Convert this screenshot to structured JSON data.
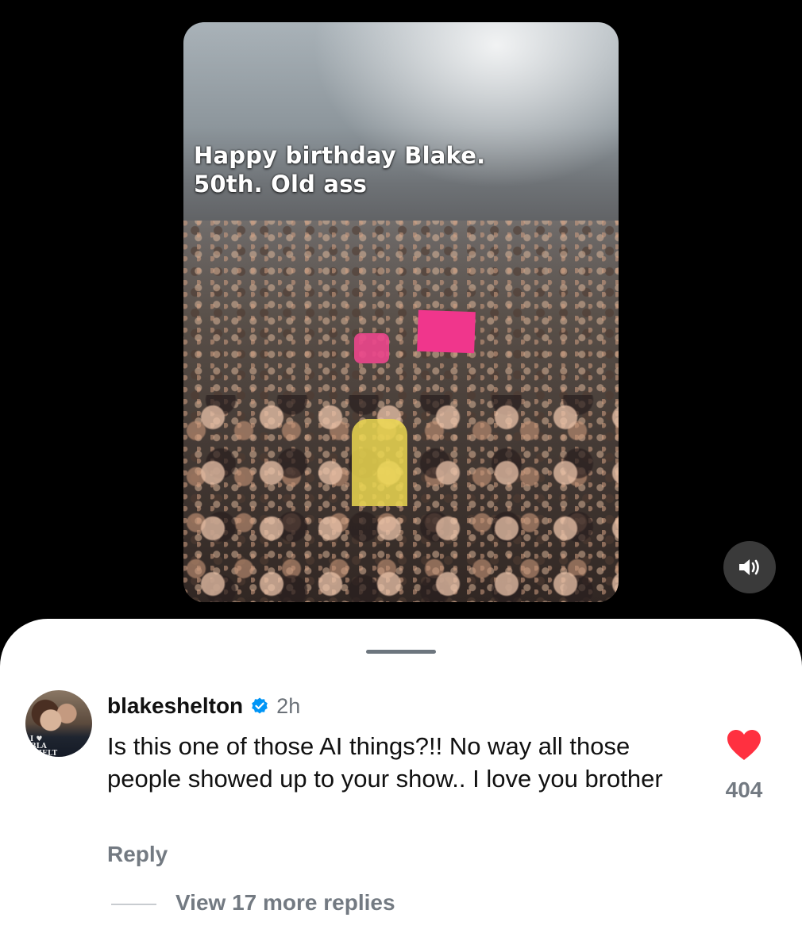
{
  "video": {
    "caption": "Happy birthday Blake.\n50th. Old ass",
    "sound_icon": "speaker-on-icon"
  },
  "comment": {
    "username": "blakeshelton",
    "verified_icon": "verified-badge-icon",
    "timestamp": "2h",
    "text": "Is this one of those AI things?!! No way all those people showed up to your show.. I love you brother",
    "avatar_shirt_text": "I ♥\nBLA\nSHELT",
    "reply_label": "Reply",
    "like_icon": "heart-filled-icon",
    "like_count": "404",
    "view_replies_label": "View 17 more replies"
  },
  "colors": {
    "background": "#000000",
    "sheet": "#ffffff",
    "like_red": "#ff3040",
    "verified_blue": "#0095f6",
    "muted_text": "#737a82"
  }
}
